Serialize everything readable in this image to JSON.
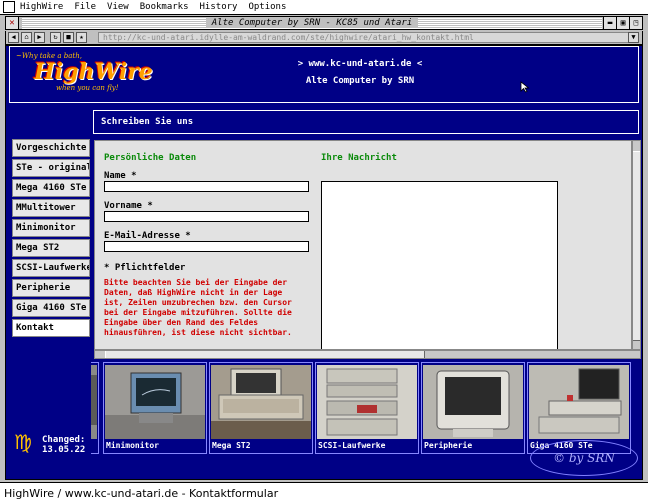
{
  "menubar": {
    "items": [
      "HighWire",
      "File",
      "View",
      "Bookmarks",
      "History",
      "Options"
    ]
  },
  "window": {
    "title": "Alte Computer by SRN - KC85 und Atari",
    "url": "http://kc-und-atari.idylle-am-waldrand.com/ste/highwire/atari_hw_kontakt.html"
  },
  "header": {
    "logo_tag_top": "~Why take a bath,",
    "logo_word": "HighWire",
    "logo_tag_bottom": "when you can fly!",
    "site": "> www.kc-und-atari.de <",
    "subtitle": "Alte Computer by SRN"
  },
  "page_title": "Schreiben Sie uns",
  "sidebar": {
    "items": [
      "Vorgeschichte",
      "STe - original",
      "Mega 4160 STe",
      "MMultitower",
      "Minimonitor",
      "Mega ST2",
      "SCSI-Laufwerke",
      "Peripherie",
      "Giga 4160 STe",
      "Kontakt"
    ]
  },
  "changed": {
    "symbol": "♍",
    "label": "Changed:",
    "date": "13.05.22"
  },
  "form": {
    "personal_heading": "Persönliche Daten",
    "message_heading": "Ihre Nachricht",
    "name_label": "Name *",
    "name_value": "",
    "vorname_label": "Vorname *",
    "vorname_value": "",
    "email_label": "E-Mail-Adresse *",
    "email_value": "",
    "required_note": "* Pflichtfelder",
    "warning": "Bitte beachten Sie bei der Eingabe der Daten, daß HighWire nicht in der Lage ist, Zeilen umzubrechen bzw. den Cursor bei der Eingabe mitzuführen. Sollte die Eingabe über den Rand des Feldes hinausführen, ist diese nicht sichtbar.",
    "message_value": ""
  },
  "gallery": {
    "items": [
      {
        "caption": "Minimonitor"
      },
      {
        "caption": "Mega ST2"
      },
      {
        "caption": "SCSI-Laufwerke"
      },
      {
        "caption": "Peripherie"
      },
      {
        "caption": "Giga 4160 STe"
      }
    ]
  },
  "watermark": "© by SRN",
  "status": "HighWire / www.kc-und-atari.de - Kontaktformular"
}
